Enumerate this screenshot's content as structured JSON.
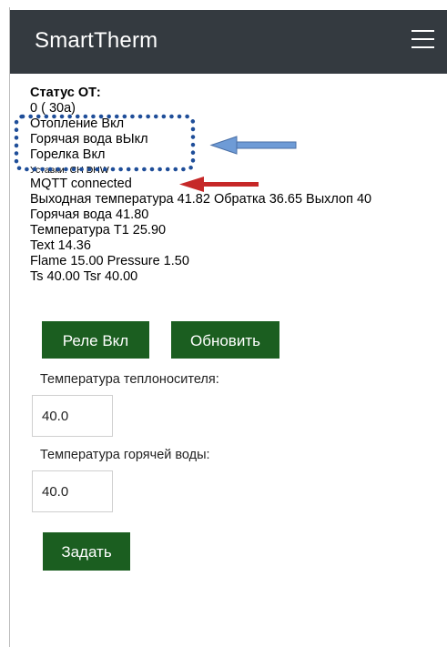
{
  "app": {
    "title": "SmartTherm",
    "menu_icon": "hamburger-icon"
  },
  "status": {
    "heading": "Статус ОТ:",
    "code": "0 ( 30a)",
    "heating": "Отопление Вкл",
    "hot_water": "Горячая вода вЫкл",
    "burner": "Горелка Вкл",
    "setpoints": "Уставки: CH DHW",
    "mqtt": "MQTT connected",
    "temps_line": "Выходная температура 41.82 Обратка 36.65 Выхлоп 40",
    "dhw_temp": "Горячая вода 41.80",
    "t1": "Температура T1 25.90",
    "text": "Text 14.36",
    "flame_pressure": "Flame 15.00 Pressure 1.50",
    "ts_tsr": "Ts 40.00 Tsr 40.00"
  },
  "buttons": {
    "relay": "Реле Вкл",
    "refresh": "Обновить",
    "set": "Задать"
  },
  "form": {
    "coolant_label": "Температура теплоносителя:",
    "coolant_value": "40.0",
    "dhw_label": "Температура горячей воды:",
    "dhw_value": "40.0"
  },
  "colors": {
    "navbar": "#343a40",
    "button": "#1b5e20",
    "annotation_dots": "#1f4e99",
    "arrow_blue": "#6e9bd6",
    "arrow_red": "#c62828"
  }
}
